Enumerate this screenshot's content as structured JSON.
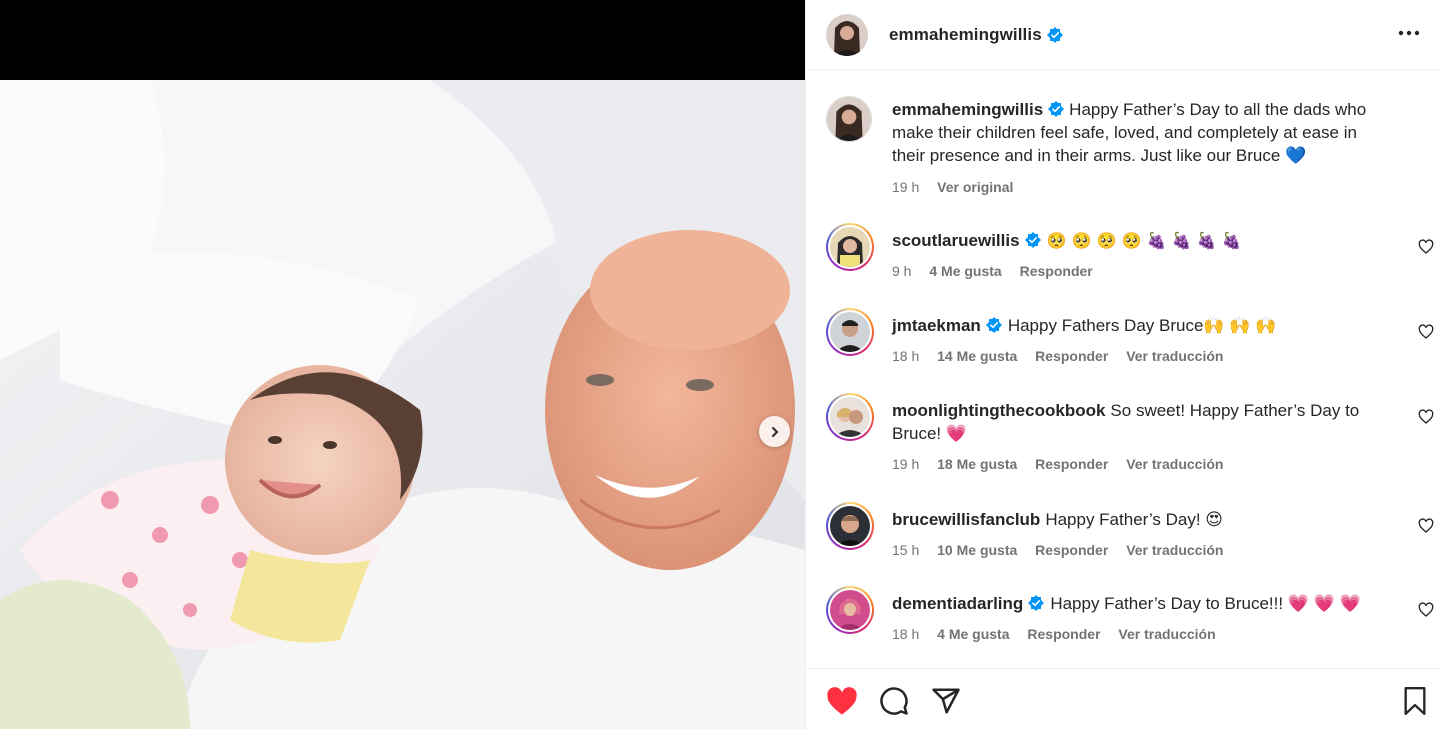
{
  "post": {
    "author": "emmahemingwillis",
    "caption": "Happy Father’s Day to all the dads who make their children feel safe, loved, and completely at ease in their presence and in their arms. Just like our Bruce 💙",
    "time": "19 h",
    "translate_label": "Ver original"
  },
  "comments": [
    {
      "user": "scoutlaruewillis",
      "verified": true,
      "text": "🥺 🥺 🥺 🥺 🍇 🍇 🍇 🍇",
      "time": "9 h",
      "likes": "4 Me gusta",
      "reply": "Responder",
      "translate": ""
    },
    {
      "user": "jmtaekman",
      "verified": true,
      "text": "Happy Fathers Day Bruce🙌 🙌 🙌",
      "time": "18 h",
      "likes": "14 Me gusta",
      "reply": "Responder",
      "translate": "Ver traducción"
    },
    {
      "user": "moonlightingthecookbook",
      "verified": false,
      "text": "So sweet! Happy Father’s Day to Bruce! 💗",
      "time": "19 h",
      "likes": "18 Me gusta",
      "reply": "Responder",
      "translate": "Ver traducción"
    },
    {
      "user": "brucewillisfanclub",
      "verified": false,
      "text": "Happy Father’s Day! 😍",
      "time": "15 h",
      "likes": "10 Me gusta",
      "reply": "Responder",
      "translate": "Ver traducción"
    },
    {
      "user": "dementiadarling",
      "verified": true,
      "text": "Happy Father’s Day to Bruce!!! 💗 💗 💗",
      "time": "18 h",
      "likes": "4 Me gusta",
      "reply": "Responder",
      "translate": "Ver traducción"
    }
  ],
  "colors": {
    "liked_heart": "#ff3040",
    "verified_blue": "#0095f6",
    "muted_text": "#737373"
  },
  "icons": {
    "liked": "heart-filled-icon",
    "comment": "comment-icon",
    "share": "paper-plane-icon",
    "save": "bookmark-icon",
    "more": "more-horizontal-icon",
    "next": "chevron-right-icon",
    "comment_like": "heart-outline-icon"
  }
}
